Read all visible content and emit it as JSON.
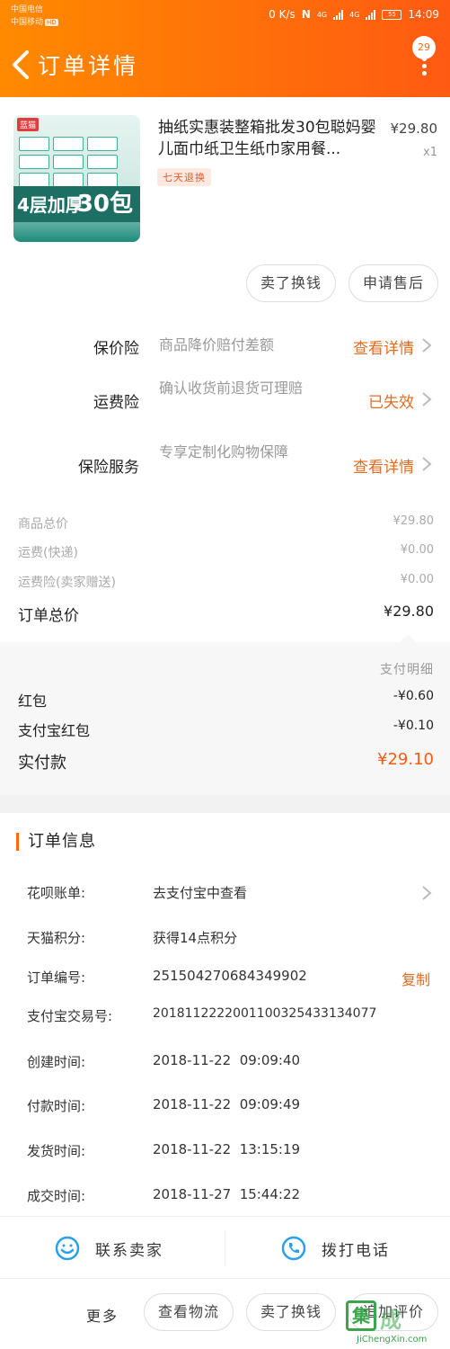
{
  "status_bar": {
    "carrier1": "中国电信",
    "carrier2": "中国移动",
    "hd": "HD",
    "speed": "0 K/s",
    "nfc": "N",
    "net1": "4G",
    "net2": "4G",
    "battery": "55",
    "time": "14:09"
  },
  "header": {
    "title": "订单详情",
    "message_count": "29"
  },
  "product": {
    "name": "抽纸实惠装整箱批发30包聪妈婴儿面巾纸卫生纸巾家用餐...",
    "price": "¥29.80",
    "quantity": "x1",
    "tag": "七天退换",
    "image_logo": "蓝猫",
    "image_text_left": "4层加厚",
    "image_text_right": "30包"
  },
  "product_actions": {
    "refund": "卖了换钱",
    "after_sale": "申请售后"
  },
  "insurance": [
    {
      "label": "保价险",
      "desc": "商品降价赔付差额",
      "link": "查看详情"
    },
    {
      "label": "运费险",
      "desc": "确认收货前退货可理赔",
      "link": "已失效"
    },
    {
      "label": "保险服务",
      "desc": "专享定制化购物保障",
      "link": "查看详情"
    }
  ],
  "summary": {
    "goods_total_label": "商品总价",
    "goods_total": "¥29.80",
    "shipping_label": "运费(快递)",
    "shipping": "¥0.00",
    "shipping_ins_label": "运费险(卖家赠送)",
    "shipping_ins": "¥0.00",
    "order_total_label": "订单总价",
    "order_total": "¥29.80"
  },
  "payment": {
    "detail_label": "支付明细",
    "red_packet_label": "红包",
    "red_packet": "-¥0.60",
    "alipay_red_label": "支付宝红包",
    "alipay_red": "-¥0.10",
    "paid_label": "实付款",
    "paid": "¥29.10"
  },
  "order_info": {
    "heading": "订单信息",
    "huabei_label": "花呗账单:",
    "huabei": "去支付宝中查看",
    "points_label": "天猫积分:",
    "points": "获得14点积分",
    "order_no_label": "订单编号:",
    "order_no": "251504270684349902",
    "copy": "复制",
    "alipay_no_label": "支付宝交易号:",
    "alipay_no": "2018112222001100325433134077",
    "created_label": "创建时间:",
    "created": "2018-11-22  09:09:40",
    "paid_label": "付款时间:",
    "paid_time": "2018-11-22  09:09:49",
    "shipped_label": "发货时间:",
    "shipped": "2018-11-22  13:15:19",
    "completed_label": "成交时间:",
    "completed": "2018-11-27  15:44:22"
  },
  "contact": {
    "seller": "联系卖家",
    "call": "拨打电话"
  },
  "bottom": {
    "more": "更多",
    "logistics": "查看物流",
    "resell": "卖了换钱",
    "review": "追加评价"
  },
  "watermark": {
    "mark": "集",
    "cn": "成",
    "url": "JiChengXin.com"
  },
  "colors": {
    "header_start": "#ff8a00",
    "header_end": "#ff5a12",
    "accent_link": "#e36c1f",
    "paid_amount": "#ff5a12"
  }
}
